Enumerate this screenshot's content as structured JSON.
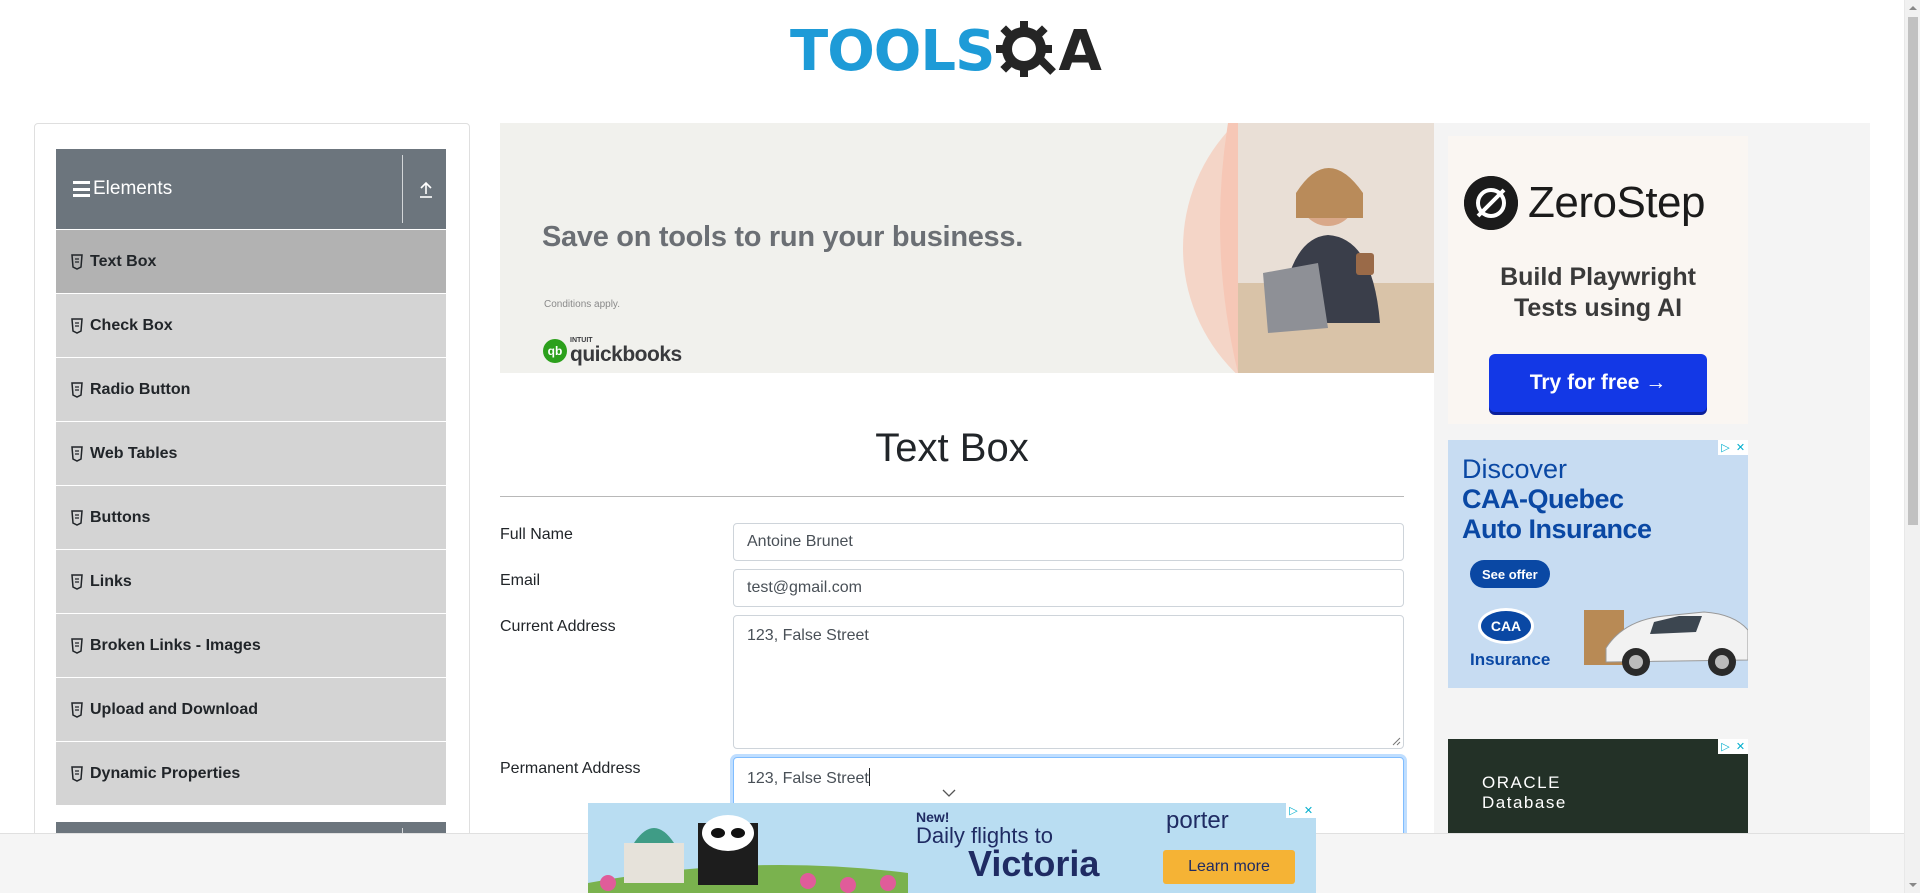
{
  "logo": {
    "tools": "TOOLS",
    "qa": "A"
  },
  "sidebar": {
    "group_title": "Elements",
    "items": [
      {
        "label": "Text Box"
      },
      {
        "label": "Check Box"
      },
      {
        "label": "Radio Button"
      },
      {
        "label": "Web Tables"
      },
      {
        "label": "Buttons"
      },
      {
        "label": "Links"
      },
      {
        "label": "Broken Links - Images"
      },
      {
        "label": "Upload and Download"
      },
      {
        "label": "Dynamic Properties"
      }
    ]
  },
  "ad_top": {
    "headline": "Save on tools to run your business.",
    "conditions": "Conditions apply.",
    "brand_small": "INTUIT",
    "brand": "quickbooks",
    "brand_mark": "qb"
  },
  "main": {
    "title": "Text Box",
    "form": {
      "full_name_label": "Full Name",
      "full_name_value": "Antoine Brunet",
      "email_label": "Email",
      "email_value": "test@gmail.com",
      "current_address_label": "Current Address",
      "current_address_value": "123, False Street",
      "permanent_address_label": "Permanent Address",
      "permanent_address_value": "123, False Street"
    }
  },
  "ad_zerostep": {
    "name": "ZeroStep",
    "tagline_1": "Build Playwright",
    "tagline_2": "Tests using AI",
    "button": "Try for free →"
  },
  "ad_caa": {
    "line1": "Discover",
    "line2": "CAA-Quebec",
    "line3": "Auto Insurance",
    "button": "See offer",
    "logo": "CAA",
    "insurance": "Insurance"
  },
  "ad_oracle": {
    "line1": "ORACLE",
    "line2": "Database"
  },
  "ad_porter": {
    "new": "New!",
    "line": "Daily flights to",
    "city": "Victoria",
    "brand": "porter",
    "button": "Learn more"
  },
  "colors": {
    "accent_blue": "#1e9bd7",
    "sidebar_header": "#6c757d",
    "menu_bg": "#d4d4d4",
    "menu_active": "#b2b2b2"
  }
}
